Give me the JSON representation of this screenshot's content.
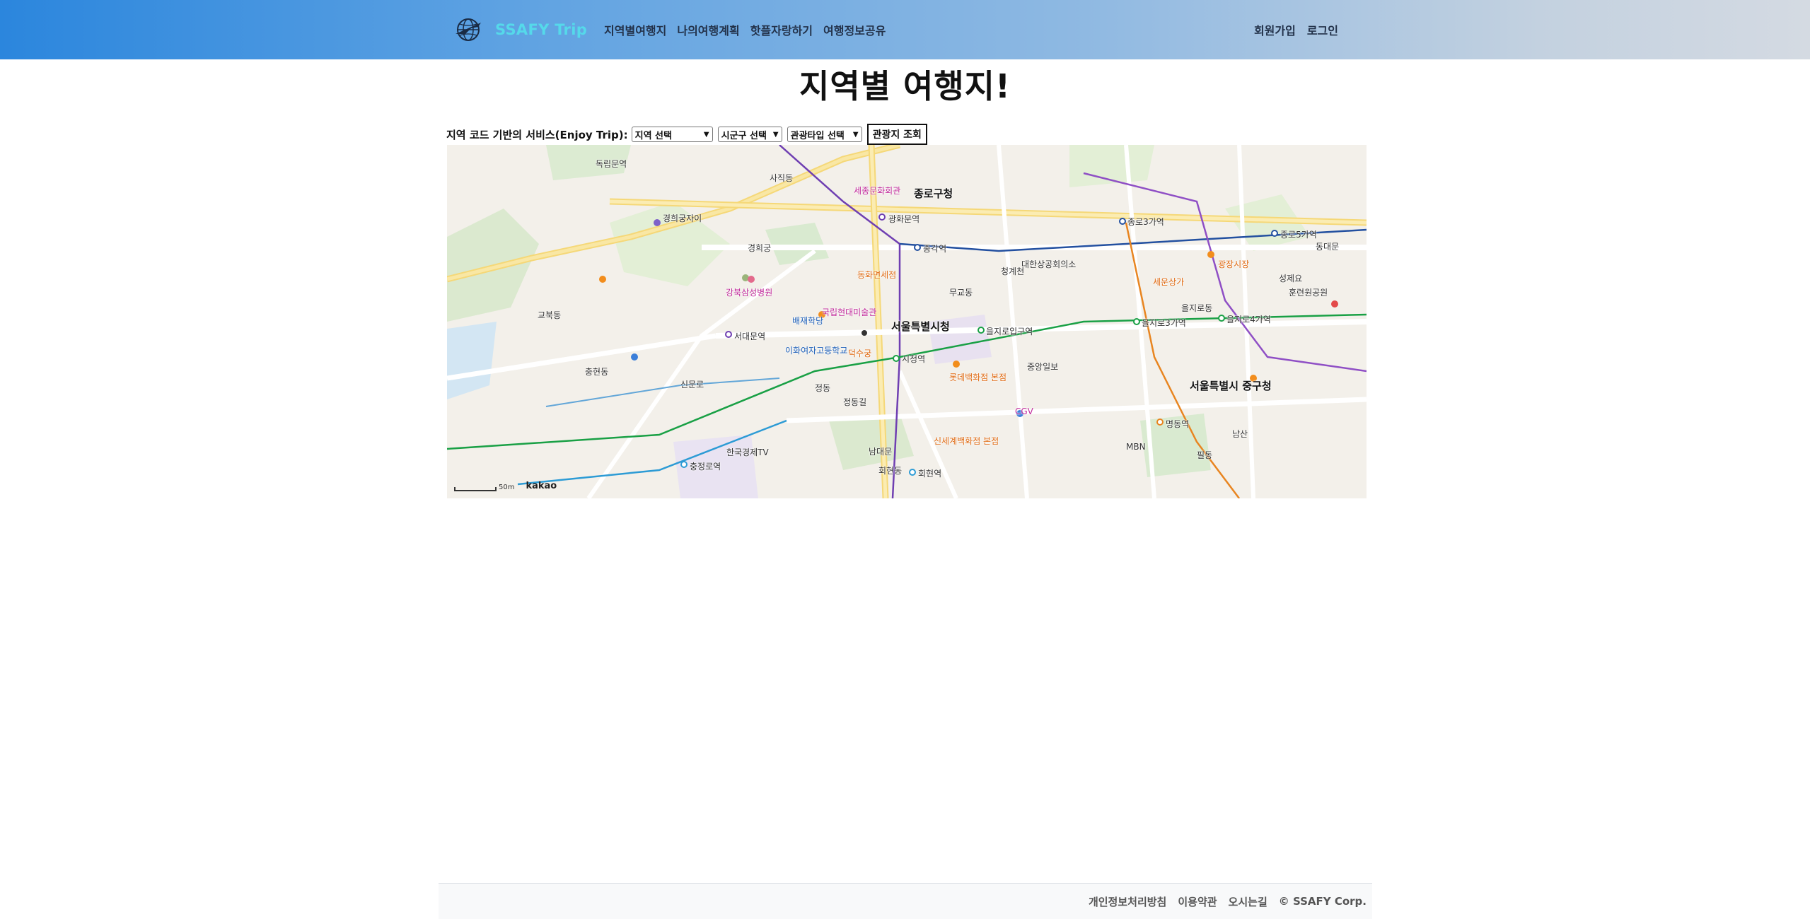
{
  "header": {
    "brand": "SSAFY Trip",
    "menu": [
      "지역별여행지",
      "나의여행계획",
      "핫플자랑하기",
      "여행정보공유"
    ],
    "right_menu": [
      "회원가입",
      "로그인"
    ],
    "gradient_start": "#2b86dd",
    "gradient_end": "#d4dae2",
    "brand_color": "#55d9ea"
  },
  "main": {
    "title": "지역별 여행지!"
  },
  "search": {
    "label": "지역 코드 기반의 서비스(Enjoy Trip):",
    "area_select": "지역 선택",
    "sigungu_select": "시군구 선택",
    "type_select": "관광타입 선택",
    "button": "관광지 조회"
  },
  "map": {
    "labels": [
      "서울특별시청",
      "종로구청",
      "서울특별시 중구청",
      "시청역",
      "광화문역",
      "종각역",
      "을지로입구역",
      "을지로3가역",
      "을지로4가역",
      "종로3가역",
      "종로5가역",
      "서대문역",
      "충정로역",
      "회현역",
      "명동역",
      "독립문역",
      "경희궁",
      "덕수궁",
      "세종문화회관",
      "롯데백화점 본점",
      "신세계백화점 본점",
      "청계천",
      "동화면세점",
      "남대문",
      "강북삼성병원",
      "이화여자고등학교",
      "배재학당",
      "경희궁자이",
      "사직동",
      "무교동",
      "국립현대미술관",
      "을지로동",
      "광장시장",
      "세운상가",
      "대한상공회의소",
      "필동",
      "회현동",
      "정동",
      "남산",
      "충현동",
      "교북동",
      "CGV",
      "MBN",
      "한국경제TV",
      "성제요",
      "훈련원공원",
      "정동길",
      "신문로",
      "동대문",
      "중앙일보"
    ],
    "scale": "50m",
    "attribution": "kakao"
  },
  "footer": {
    "links": [
      "개인정보처리방침",
      "이용약관",
      "오시는길"
    ],
    "copyright": "© SSAFY Corp."
  }
}
